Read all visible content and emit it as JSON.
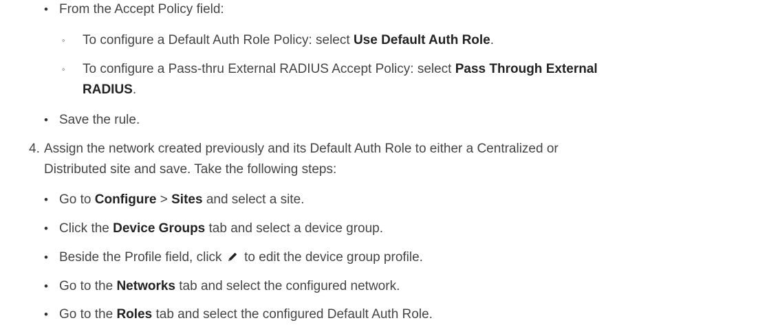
{
  "steps": {
    "accept_policy": {
      "text": "From the Accept Policy field:",
      "sub_items": [
        {
          "prefix": "To configure a Default Auth Role Policy: select ",
          "bold": "Use Default Auth Role",
          "suffix": "."
        },
        {
          "prefix": "To configure a Pass-thru External RADIUS Accept Policy: select ",
          "bold_line1": "Pass Through External",
          "bold_line2": "RADIUS",
          "suffix": "."
        }
      ]
    },
    "save_rule": {
      "text": "Save the rule."
    },
    "step4": {
      "number": "4.",
      "line1": "Assign the network created previously and its Default Auth Role to either a Centralized or",
      "line2": "Distributed site and save. Take the following steps:",
      "items": [
        {
          "t1": "Go to ",
          "b1": "Configure",
          "t2": " > ",
          "b2": "Sites",
          "t3": " and select a site."
        },
        {
          "t1": "Click the ",
          "b1": "Device Groups",
          "t2": " tab and select a device group."
        },
        {
          "t1": "Beside the Profile field, click ",
          "icon": "pencil-icon",
          "t2": " to edit the device group profile."
        },
        {
          "t1": "Go to the ",
          "b1": "Networks",
          "t2": " tab and select the configured network."
        },
        {
          "t1": "Go to the ",
          "b1": "Roles",
          "t2": " tab and select the configured Default Auth Role."
        }
      ]
    }
  },
  "glyphs": {
    "bullet": "•",
    "sub_bullet": "◦"
  },
  "colors": {
    "text": "#444444",
    "bold": "#222222"
  }
}
